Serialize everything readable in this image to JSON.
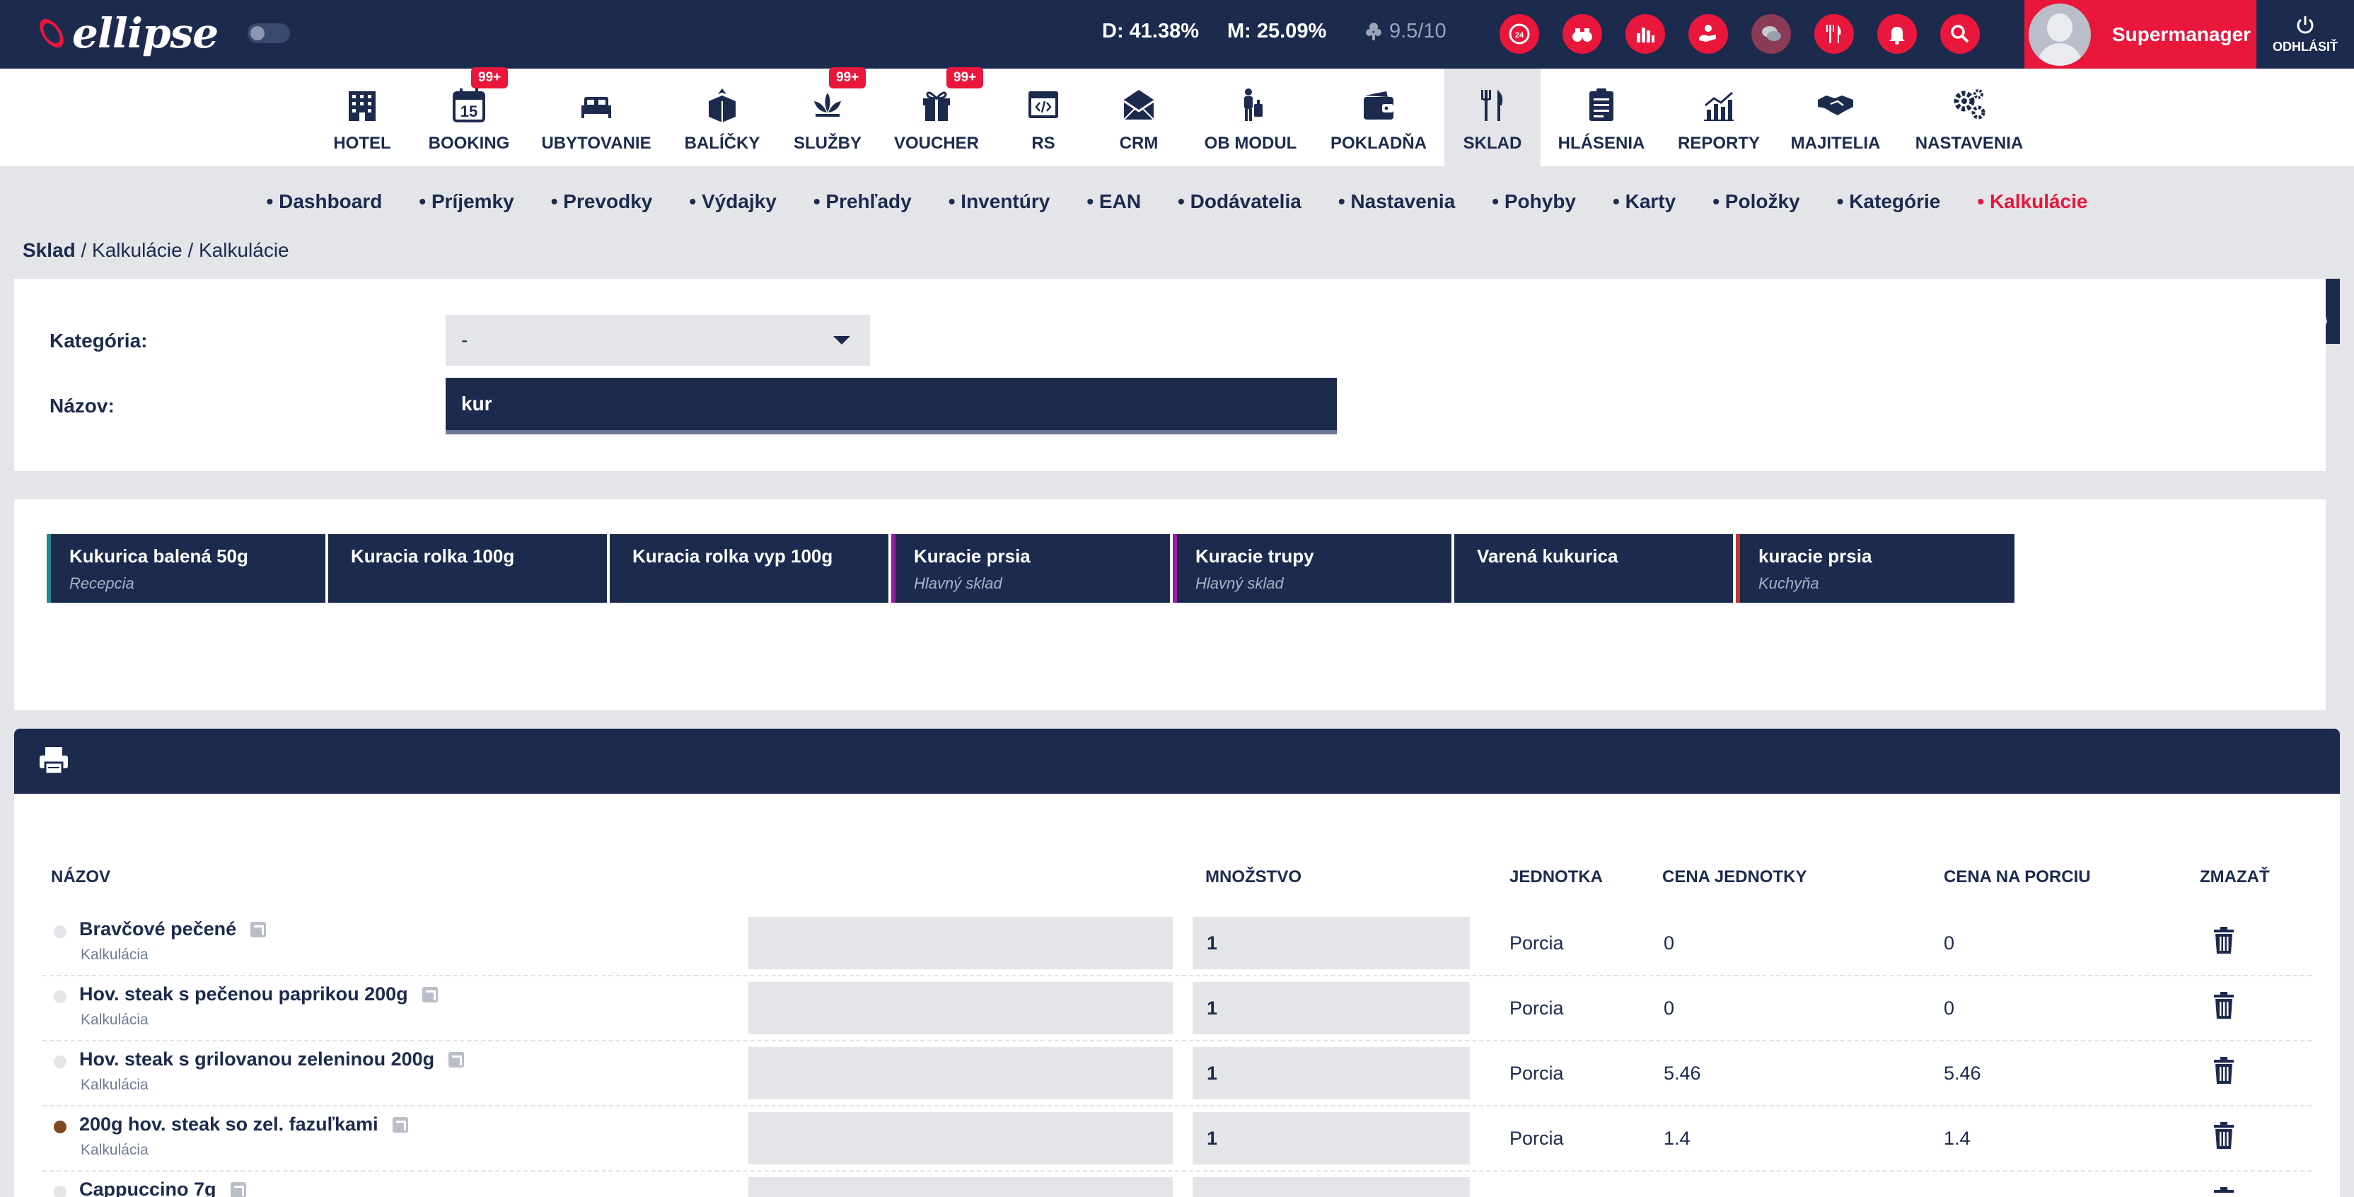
{
  "topbar": {
    "logo": "ellipse",
    "stat_d": "D: 41.38%",
    "stat_m": "M: 25.09%",
    "rating": "9.5/10",
    "user_name": "Supermanager",
    "logout_label": "ODHLÁSIŤ",
    "icons": [
      "24h-clock-icon",
      "binoculars-icon",
      "bar-chart-icon",
      "helping-hand-icon",
      "chat-icon",
      "fork-knife-icon",
      "bell-icon",
      "search-icon"
    ],
    "accent": "#e8173b",
    "navy": "#1c2a4e"
  },
  "modules": [
    {
      "label": "HOTEL",
      "icon": "building-icon"
    },
    {
      "label": "BOOKING",
      "icon": "calendar-icon",
      "badge": "99+"
    },
    {
      "label": "UBYTOVANIE",
      "icon": "bed-icon"
    },
    {
      "label": "BALÍČKY",
      "icon": "package-icon"
    },
    {
      "label": "SLUŽBY",
      "icon": "lotus-icon",
      "badge": "99+"
    },
    {
      "label": "VOUCHER",
      "icon": "gift-icon",
      "badge": "99+"
    },
    {
      "label": "RS",
      "icon": "code-window-icon"
    },
    {
      "label": "CRM",
      "icon": "envelope-icon"
    },
    {
      "label": "OB MODUL",
      "icon": "traveler-icon"
    },
    {
      "label": "POKLADŇA",
      "icon": "wallet-icon"
    },
    {
      "label": "SKLAD",
      "icon": "cutlery-icon",
      "active": true
    },
    {
      "label": "HLÁSENIA",
      "icon": "clipboard-icon"
    },
    {
      "label": "REPORTY",
      "icon": "growth-chart-icon"
    },
    {
      "label": "MAJITELIA",
      "icon": "handshake-icon"
    },
    {
      "label": "NASTAVENIA",
      "icon": "gears-icon"
    }
  ],
  "subnav": [
    "Dashboard",
    "Príjemky",
    "Prevodky",
    "Výdajky",
    "Prehľady",
    "Inventúry",
    "EAN",
    "Dodávatelia",
    "Nastavenia",
    "Pohyby",
    "Karty",
    "Položky",
    "Kategórie",
    "Kalkulácie"
  ],
  "subnav_active": "Kalkulácie",
  "breadcrumb": {
    "root": "Sklad",
    "rest": " / Kalkulácie / Kalkulácie"
  },
  "filter": {
    "category_label": "Kategória:",
    "category_value": "-",
    "name_label": "Názov:",
    "name_value": "kur"
  },
  "results": [
    {
      "name": "Kukurica balená 50g",
      "sub": "Recepcia",
      "color": "#1e8a8a"
    },
    {
      "name": "Kuracia rolka 100g",
      "sub": "",
      "color": ""
    },
    {
      "name": "Kuracia rolka vyp 100g",
      "sub": "",
      "color": ""
    },
    {
      "name": "Kuracie prsia",
      "sub": "Hlavný sklad",
      "color": "#9c1aa6"
    },
    {
      "name": "Kuracie trupy",
      "sub": "Hlavný sklad",
      "color": "#9c1aa6"
    },
    {
      "name": "Varená kukurica",
      "sub": "",
      "color": ""
    },
    {
      "name": "kuracie prsia",
      "sub": "Kuchyňa",
      "color": "#c0392b"
    }
  ],
  "table": {
    "headers": {
      "name": "NÁZOV",
      "qty": "MNOŽSTVO",
      "unit": "JEDNOTKA",
      "unit_price": "CENA JEDNOTKY",
      "portion_price": "CENA NA PORCIU",
      "delete": "ZMAZAŤ"
    },
    "rows": [
      {
        "name": "Bravčové pečené",
        "sub": "Kalkulácia",
        "qty": "1",
        "unit": "Porcia",
        "unit_price": "0",
        "portion_price": "0",
        "dot": "#e4e5e9"
      },
      {
        "name": "Hov. steak s pečenou paprikou 200g",
        "sub": "Kalkulácia",
        "qty": "1",
        "unit": "Porcia",
        "unit_price": "0",
        "portion_price": "0",
        "dot": "#e4e5e9"
      },
      {
        "name": "Hov. steak s grilovanou zeleninou 200g",
        "sub": "Kalkulácia",
        "qty": "1",
        "unit": "Porcia",
        "unit_price": "5.46",
        "portion_price": "5.46",
        "dot": "#e4e5e9"
      },
      {
        "name": "200g hov. steak so zel. fazuľkami",
        "sub": "Kalkulácia",
        "qty": "1",
        "unit": "Porcia",
        "unit_price": "1.4",
        "portion_price": "1.4",
        "dot": "#7a4a1e"
      },
      {
        "name": "Cappuccino 7g",
        "sub": "",
        "qty": "",
        "unit": "",
        "unit_price": "",
        "portion_price": "",
        "dot": "#e4e5e9"
      }
    ]
  }
}
